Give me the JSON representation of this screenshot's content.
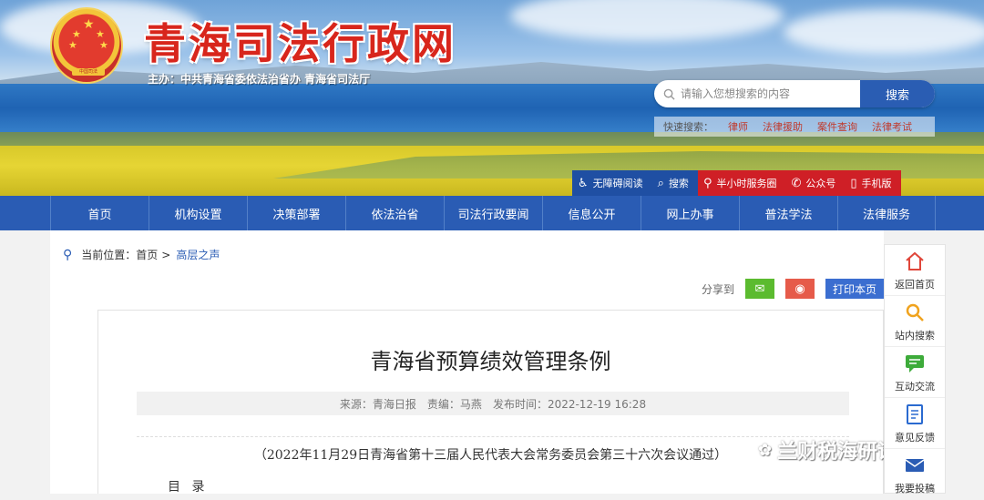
{
  "header": {
    "site_title": "青海司法行政网",
    "sponsor": "主办：中共青海省委依法治省办   青海省司法厅",
    "emblem_text": "中国司法"
  },
  "search": {
    "placeholder": "请输入您想搜索的内容",
    "button": "搜索",
    "quick_label": "快速搜索：",
    "quick_items": [
      "律师",
      "法律援助",
      "案件查询",
      "法律考试"
    ]
  },
  "service_bar": [
    {
      "label": "无障碍阅读",
      "icon": "accessibility-icon"
    },
    {
      "label": "搜索",
      "icon": "search-icon"
    },
    {
      "label": "半小时服务圈",
      "icon": "location-icon"
    },
    {
      "label": "公众号",
      "icon": "wechat-icon"
    },
    {
      "label": "手机版",
      "icon": "mobile-icon"
    }
  ],
  "nav": [
    "首页",
    "机构设置",
    "决策部署",
    "依法治省",
    "司法行政要闻",
    "信息公开",
    "网上办事",
    "普法学法",
    "法律服务"
  ],
  "breadcrumb": {
    "label": "当前位置：",
    "home": "首页",
    "sep": ">",
    "current": "高层之声"
  },
  "share": {
    "label": "分享到",
    "print": "打印本页"
  },
  "article": {
    "title": "青海省预算绩效管理条例",
    "source": "来源：青海日报",
    "editor": "责编：马燕",
    "published": "发布时间：2022-12-19 16:28",
    "subtitle": "（2022年11月29日青海省第十三届人民代表大会常务委员会第三十六次会议通过）",
    "toc": "目 录"
  },
  "float_bar": [
    {
      "label": "返回首页",
      "icon": "home-icon"
    },
    {
      "label": "站内搜索",
      "icon": "search-icon"
    },
    {
      "label": "互动交流",
      "icon": "chat-icon"
    },
    {
      "label": "意见反馈",
      "icon": "feedback-icon"
    },
    {
      "label": "我要投稿",
      "icon": "mail-icon"
    }
  ],
  "watermark": "兰财税海研语",
  "colors": {
    "nav_blue": "#2a5cb4",
    "title_red": "#d8261c",
    "service_red": "#cf1f26",
    "service_blue": "#1f4fa3"
  }
}
